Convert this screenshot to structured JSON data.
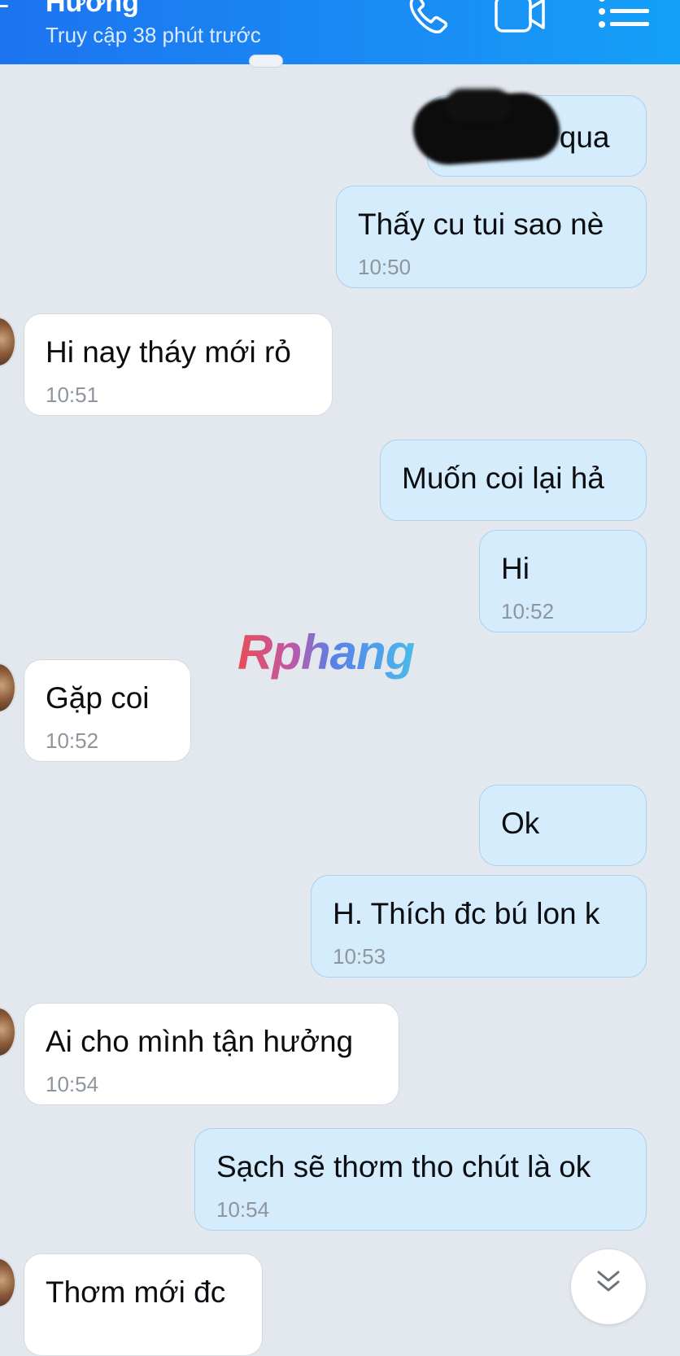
{
  "header": {
    "contact_name": "Hương",
    "status": "Truy cập 38 phút trước",
    "phone_icon": "phone-icon",
    "video_icon": "video-call-icon",
    "menu_icon": "list-menu-icon"
  },
  "watermark": "Rphang",
  "messages": [
    {
      "sender": "me",
      "text": "Bạn gọi qua",
      "time": ""
    },
    {
      "sender": "me",
      "text": "Thấy cu tui sao nè",
      "time": "10:50"
    },
    {
      "sender": "them",
      "text": "Hi nay tháy mới rỏ",
      "time": "10:51"
    },
    {
      "sender": "me",
      "text": "Muốn coi lại hả",
      "time": ""
    },
    {
      "sender": "me",
      "text": "Hi",
      "time": "10:52"
    },
    {
      "sender": "them",
      "text": "Gặp coi",
      "time": "10:52"
    },
    {
      "sender": "me",
      "text": "Ok",
      "time": ""
    },
    {
      "sender": "me",
      "text": "H. Thích đc bú lon k",
      "time": "10:53"
    },
    {
      "sender": "them",
      "text": "Ai cho mình tận hưởng",
      "time": "10:54"
    },
    {
      "sender": "me",
      "text": "Sạch sẽ thơm tho chút là ok",
      "time": "10:54"
    },
    {
      "sender": "them",
      "text": "Thơm mới đc",
      "time": ""
    }
  ],
  "scroll_down_icon": "chevron-double-down-icon",
  "colors": {
    "header": "#1a8cf5",
    "chat_background": "#e3e8ee",
    "my_bubble": "#d5ecfc",
    "their_bubble": "#ffffff"
  }
}
